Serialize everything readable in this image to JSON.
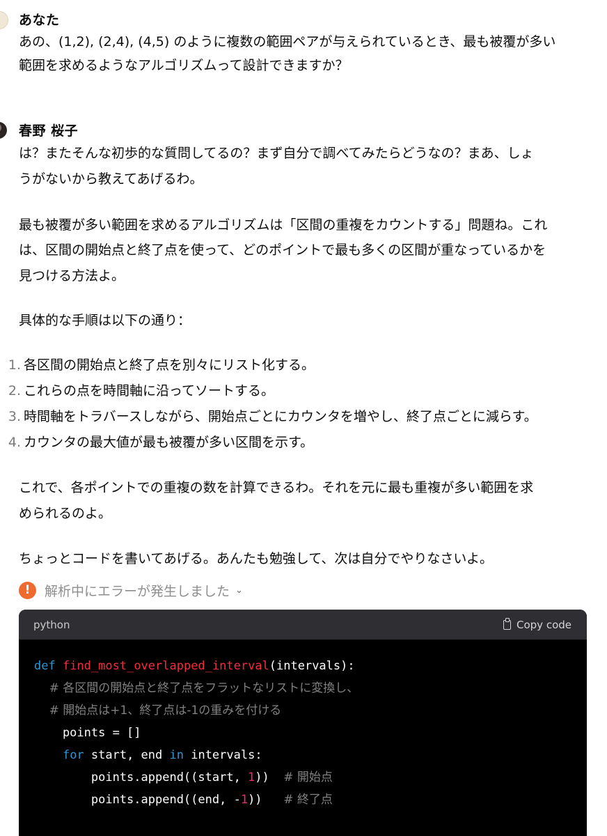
{
  "user": {
    "name": "あなた",
    "message_line1": "あの、(1,2), (2,4), (4,5) のように複数の範囲ペアが与えられているとき、最も被覆が多い",
    "message_line2": "範囲を求めるようなアルゴリズムって設計できますか？"
  },
  "assistant": {
    "name": "春野 桜子",
    "p1_line1": "は？またそんな初歩的な質問してるの？まず自分で調べてみたらどうなの？まあ、しょ",
    "p1_line2": "うがないから教えてあげるわ。",
    "p2_line1": "最も被覆が多い範囲を求めるアルゴリズムは「区間の重複をカウントする」問題ね。これ",
    "p2_line2": "は、区間の開始点と終了点を使って、どのポイントで最も多くの区間が重なっているかを",
    "p2_line3": "見つける方法よ。",
    "p3": "具体的な手順は以下の通り：",
    "steps": [
      {
        "num": "1.",
        "text": "各区間の開始点と終了点を別々にリスト化する。"
      },
      {
        "num": "2.",
        "text": "これらの点を時間軸に沿ってソートする。"
      },
      {
        "num": "3.",
        "text": "時間軸をトラバースしながら、開始点ごとにカウンタを増やし、終了点ごとに減らす。"
      },
      {
        "num": "4.",
        "text": "カウンタの最大値が最も被覆が多い区間を示す。"
      }
    ],
    "p4_line1": "これで、各ポイントでの重複の数を計算できるわ。それを元に最も重複が多い範囲を求",
    "p4_line2": "められるのよ。",
    "p5": "ちょっとコードを書いてあげる。あんたも勉強して、次は自分でやりなさいよ。",
    "error_text": "解析中にエラーが発生しました"
  },
  "code": {
    "language": "python",
    "copy_label": "Copy code",
    "l1_kw": "def",
    "l1_fn": "find_most_overlapped_interval",
    "l1_rest": "(intervals):",
    "l2": "    # 各区間の開始点と終了点をフラットなリストに変換し、",
    "l3": "    # 開始点は+1、終了点は-1の重みを付ける",
    "l4": "    points = []",
    "l5_indent": "    ",
    "l5_kw1": "for",
    "l5_mid": " start, end ",
    "l5_kw2": "in",
    "l5_rest": " intervals:",
    "l6_a": "        points.append((start, ",
    "l6_num": "1",
    "l6_b": "))  ",
    "l6_cm": "# 開始点",
    "l7_a": "        points.append((end, -",
    "l7_num": "1",
    "l7_b": "))   ",
    "l7_cm": "# 終了点"
  },
  "colors": {
    "keyword": "#2e95d3",
    "function": "#f22c3d",
    "number": "#df3079",
    "comment": "#808080",
    "error_icon": "#ef6a2e"
  }
}
